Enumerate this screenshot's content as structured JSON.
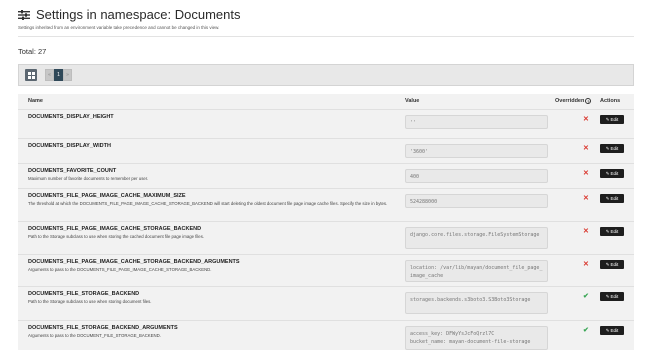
{
  "header": {
    "title": "Settings in namespace: Documents",
    "subtitle": "Settings inherited from an environment variable take precedence and cannot be changed in this view."
  },
  "total": "Total: 27",
  "pager": {
    "prev": "«",
    "current": "1",
    "next": "»"
  },
  "table": {
    "headers": {
      "name": "Name",
      "value": "Value",
      "overridden": "Overridden",
      "actions": "Actions"
    },
    "edit_label": "Edit",
    "rows": [
      {
        "name": "DOCUMENTS_DISPLAY_HEIGHT",
        "description": "",
        "value": "''",
        "overridden": false
      },
      {
        "name": "DOCUMENTS_DISPLAY_WIDTH",
        "description": "",
        "value": "'3600'",
        "overridden": false
      },
      {
        "name": "DOCUMENTS_FAVORITE_COUNT",
        "description": "Maximum number of favorite documents to remember per user.",
        "value": "400",
        "overridden": false
      },
      {
        "name": "DOCUMENTS_FILE_PAGE_IMAGE_CACHE_MAXIMUM_SIZE",
        "description": "The threshold at which the DOCUMENTS_FILE_PAGE_IMAGE_CACHE_STORAGE_BACKEND will start deleting the oldest document file page image cache files. Specify the size in bytes.",
        "value": "524288000",
        "overridden": false
      },
      {
        "name": "DOCUMENTS_FILE_PAGE_IMAGE_CACHE_STORAGE_BACKEND",
        "description": "Path to the Storage subclass to use when storing the cached document file page image files.",
        "value": "django.core.files.storage.FileSystemStorage",
        "overridden": false
      },
      {
        "name": "DOCUMENTS_FILE_PAGE_IMAGE_CACHE_STORAGE_BACKEND_ARGUMENTS",
        "description": "Arguments to pass to the DOCUMENTS_FILE_PAGE_IMAGE_CACHE_STORAGE_BACKEND.",
        "value": "location: /var/lib/mayan/document_file_page_image_cache",
        "overridden": false
      },
      {
        "name": "DOCUMENTS_FILE_STORAGE_BACKEND",
        "description": "Path to the Storage subclass to use when storing document files.",
        "value": "storages.backends.s3boto3.S3Boto3Storage",
        "overridden": true
      },
      {
        "name": "DOCUMENTS_FILE_STORAGE_BACKEND_ARGUMENTS",
        "description": "Arguments to pass to the DOCUMENT_FILE_STORAGE_BACKEND.",
        "value": "access_key: DFWyYsJcFoQrzl7C\nbucket_name: mayan-document-file-storage",
        "overridden": true
      }
    ]
  },
  "icons": {
    "overridden_true": "✔",
    "overridden_false": "✕"
  },
  "colors": {
    "x": "#d9342b",
    "check": "#3aa655",
    "active_page": "#2f4858",
    "edit_button": "#1e1e1e"
  }
}
